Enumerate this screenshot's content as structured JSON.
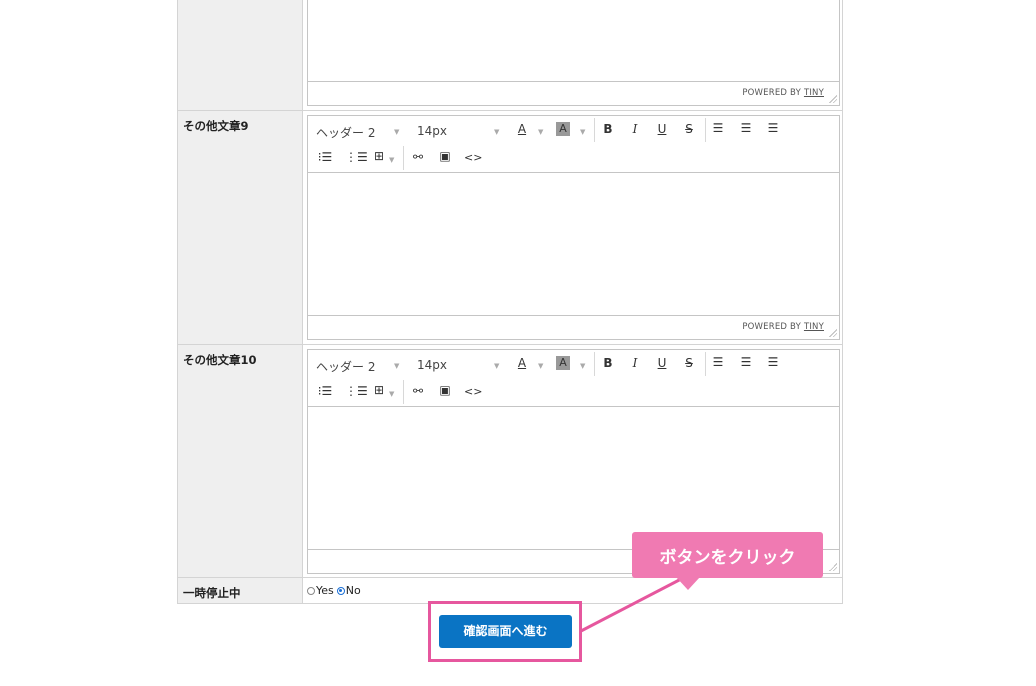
{
  "form": {
    "rows": [
      {
        "label": ""
      },
      {
        "label": "その他文章9"
      },
      {
        "label": "その他文章10"
      },
      {
        "label": "一時停止中"
      }
    ]
  },
  "editor": {
    "block_format": "ヘッダー 2",
    "font_size": "14px",
    "powered_by": "POWERED BY",
    "tiny": "TINY",
    "buttons": {
      "text_color": "A",
      "bg_color": "A",
      "bold": "B",
      "italic": "I",
      "underline": "U",
      "strike": "S",
      "code": "<>"
    }
  },
  "pause": {
    "yes": "Yes",
    "no": "No",
    "selected": "No"
  },
  "submit_label": "確認画面へ進む",
  "callout_text": "ボタンをクリック",
  "colors": {
    "submit_bg": "#0a74c4",
    "callout_bg": "#f07ab2",
    "highlight": "#e6579e"
  }
}
